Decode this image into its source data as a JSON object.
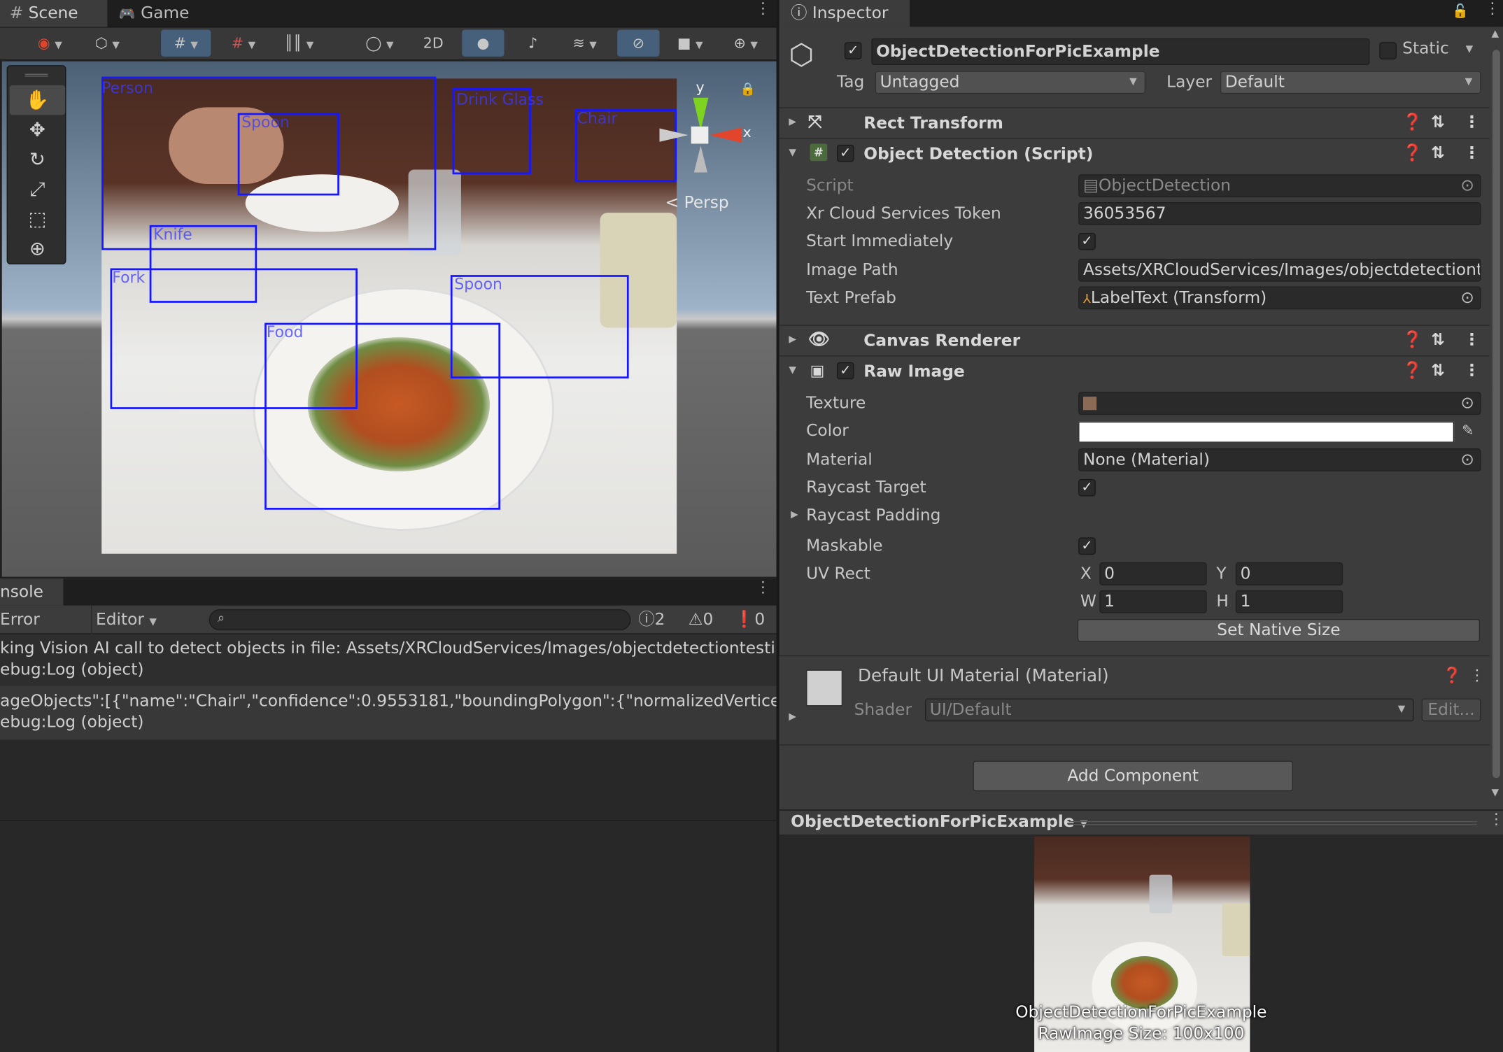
{
  "scene_tabs": {
    "scene": "Scene",
    "game": "Game"
  },
  "scene_toolbar": {
    "two_d": "2D"
  },
  "gizmo": {
    "y": "y",
    "x": "x",
    "persp": "< Persp"
  },
  "detections": [
    {
      "label": "Person"
    },
    {
      "label": "Spoon"
    },
    {
      "label": "Drink Glass"
    },
    {
      "label": "Chair"
    },
    {
      "label": "Knife"
    },
    {
      "label": "Fork"
    },
    {
      "label": "Spoon"
    },
    {
      "label": "Food"
    }
  ],
  "console": {
    "tab": "nsole",
    "error_pause": "Error Pause",
    "editor": "Editor",
    "counts": {
      "info": "2",
      "warn": "0",
      "error": "0"
    },
    "lines": [
      "king Vision AI call to detect objects in file: Assets/XRCloudServices/Images/objectdetectiontestimag",
      "ebug:Log (object)",
      "ageObjects\":[{\"name\":\"Chair\",\"confidence\":0.9553181,\"boundingPolygon\":{\"normalizedVertices\":[{\"x",
      "ebug:Log (object)"
    ]
  },
  "inspector": {
    "tab": "Inspector",
    "object_name": "ObjectDetectionForPicExample",
    "static_label": "Static",
    "tag_label": "Tag",
    "tag_value": "Untagged",
    "layer_label": "Layer",
    "layer_value": "Default",
    "components": {
      "rect_transform": "Rect Transform",
      "object_detection": "Object Detection (Script)",
      "canvas_renderer": "Canvas Renderer",
      "raw_image": "Raw Image"
    },
    "script_fields": {
      "script_label": "Script",
      "script_value": "ObjectDetection",
      "token_label": "Xr Cloud Services Token",
      "token_value": "36053567",
      "start_label": "Start Immediately",
      "path_label": "Image Path",
      "path_value": "Assets/XRCloudServices/Images/objectdetectionte",
      "prefab_label": "Text Prefab",
      "prefab_value": "LabelText (Transform)"
    },
    "raw_image_fields": {
      "texture_label": "Texture",
      "color_label": "Color",
      "material_label": "Material",
      "material_value": "None (Material)",
      "raycast_label": "Raycast Target",
      "padding_label": "Raycast Padding",
      "maskable_label": "Maskable",
      "uv_label": "UV Rect",
      "x_label": "X",
      "x_value": "0",
      "y_label": "Y",
      "y_value": "0",
      "w_label": "W",
      "w_value": "1",
      "h_label": "H",
      "h_value": "1",
      "native_size": "Set Native Size"
    },
    "material": {
      "title": "Default UI Material (Material)",
      "shader_label": "Shader",
      "shader_value": "UI/Default",
      "edit": "Edit..."
    },
    "add_component": "Add Component"
  },
  "preview": {
    "title": "ObjectDetectionForPicExample",
    "caption1": "ObjectDetectionForPicExample",
    "caption2": "RawImage Size: 100x100"
  },
  "colors": {
    "accent_blue": "#1616ff",
    "gizmo_green": "#7ed321",
    "gizmo_red": "#e2452b",
    "panel": "#282828",
    "header": "#3c3c3c"
  }
}
